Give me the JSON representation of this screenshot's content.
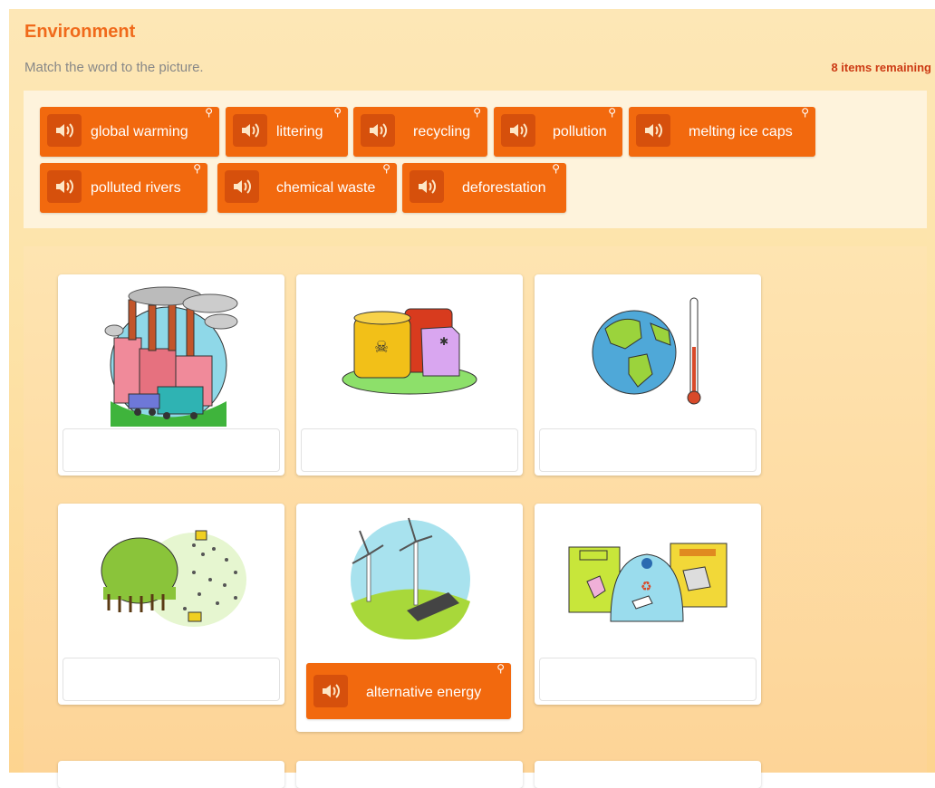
{
  "header": {
    "title": "Environment",
    "instruction": "Match the word to the picture.",
    "remaining": "8 items remaining"
  },
  "word_bank": [
    {
      "label": "global warming"
    },
    {
      "label": "littering"
    },
    {
      "label": "recycling"
    },
    {
      "label": "pollution"
    },
    {
      "label": "melting ice caps"
    },
    {
      "label": "polluted rivers"
    },
    {
      "label": "chemical waste"
    },
    {
      "label": "deforestation"
    }
  ],
  "cards": [
    {
      "picture": "factory-smoke-picture",
      "answer": ""
    },
    {
      "picture": "chemical-barrels-picture",
      "answer": ""
    },
    {
      "picture": "globe-thermometer-picture",
      "answer": ""
    },
    {
      "picture": "forest-bulldozer-picture",
      "answer": ""
    },
    {
      "picture": "wind-turbines-picture",
      "answer": "alternative energy"
    },
    {
      "picture": "recycling-bins-picture",
      "answer": ""
    }
  ],
  "colors": {
    "accent": "#f2690e",
    "title": "#f06a1b",
    "remaining": "#cc3a14"
  },
  "icons": {
    "speaker": "speaker-icon",
    "pin": "pin-icon"
  }
}
